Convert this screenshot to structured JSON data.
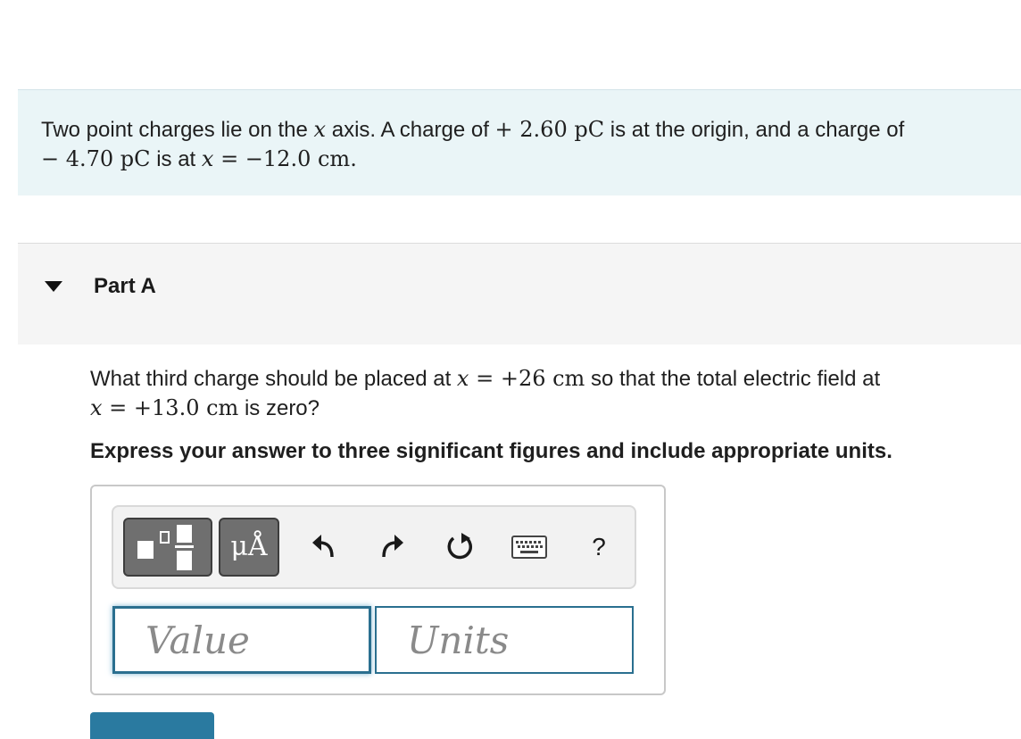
{
  "intro": {
    "line1_pre": "Two point charges lie on the ",
    "line1_x": "x",
    "line1_mid": " axis. A charge of ",
    "line1_charge": "+ 2.60 pC",
    "line1_post": " is at the origin, and a charge of",
    "line2_charge": "− 4.70 pC",
    "line2_mid": " is at ",
    "line2_x": "x",
    "line2_value": " = −12.0 cm",
    "line2_post": "."
  },
  "part": {
    "title": "Part A"
  },
  "question": {
    "line1_pre": "What third charge should be placed at ",
    "line1_x": "x",
    "line1_value": " = +26 cm",
    "line1_post": " so that the total electric field at",
    "line2_x": "x",
    "line2_value": " = +13.0 cm",
    "line2_post": " is zero?"
  },
  "instruction": "Express your answer to three significant figures and include appropriate units.",
  "toolbar": {
    "units_label": "μÅ",
    "help_label": "?",
    "icons": [
      "templates-icon",
      "units-icon",
      "undo-icon",
      "redo-icon",
      "reset-icon",
      "keyboard-icon",
      "help-icon"
    ]
  },
  "inputs": {
    "value_placeholder": "Value",
    "units_placeholder": "Units"
  }
}
